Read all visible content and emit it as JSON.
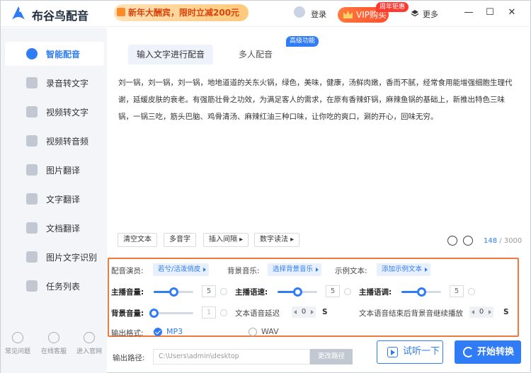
{
  "header": {
    "app_title": "布谷鸟配音",
    "promo": "新年大酬宾，限时立减200元",
    "login": "登录",
    "vip": "VIP购买",
    "vip_badge": "周年钜惠",
    "more": "更多",
    "window_controls": [
      "—",
      "☐",
      "✕"
    ]
  },
  "sidebar": {
    "items": [
      {
        "label": "智能配音",
        "icon": "microphone-icon"
      },
      {
        "label": "录音转文字",
        "icon": "audio-text-icon"
      },
      {
        "label": "视频转文字",
        "icon": "video-text-icon"
      },
      {
        "label": "视频转音频",
        "icon": "video-audio-icon"
      },
      {
        "label": "图片翻译",
        "icon": "image-translate-icon"
      },
      {
        "label": "文字翻译",
        "icon": "text-translate-icon"
      },
      {
        "label": "文档翻译",
        "icon": "doc-translate-icon"
      },
      {
        "label": "图片文字识别",
        "icon": "ocr-icon"
      },
      {
        "label": "任务列表",
        "icon": "task-list-icon"
      }
    ],
    "footer": [
      "常见问题",
      "在线客服",
      "进入官网"
    ]
  },
  "main": {
    "tabs": [
      "输入文字进行配音",
      "多人配音"
    ],
    "tab_badge": "高级功能",
    "text": "刘一锅，刘一锅，刘一锅，地地道道的关东火锅，绿色，美味，健康，汤鲜肉嫩，香而不腻，经常食用能增强细胞生理代谢，延缓皮肤的衰老。有强筋壮骨之功效，为满足客人的需求，在原有香辣虾锅，麻辣鱼锅的基础上，新推出特色三味锅，一锅三吃，筋头巴脑、鸡骨清汤、麻辣红油三种口味，让你吃的爽口，涮的开心，回味无穷。",
    "tools": [
      "清空文本",
      "多音字",
      "插入间隔 ▸",
      "数字读法 ▸"
    ],
    "char_count": "148",
    "char_limit": "/ 3000"
  },
  "settings": {
    "voice_label": "配音演员:",
    "voice_value": "若兮/活泼俏皮",
    "bgm_label": "背景音乐:",
    "bgm_value": "选择背景音乐",
    "sample_label": "示例文本:",
    "sample_value": "添加示例文本",
    "main_volume_label": "主播音量:",
    "main_volume": "5",
    "main_volume_level": 0.5,
    "speed_label": "主播语速:",
    "speed": "5",
    "speed_level": 0.5,
    "pitch_label": "主播语调:",
    "pitch": "5",
    "pitch_level": 0.5,
    "bg_volume_label": "背景音量:",
    "bg_volume": "1",
    "bg_volume_level": 0.0,
    "delay_label": "文本语音延迟",
    "delay_value": "0",
    "delay_unit": "S",
    "continue_label": "文本语音结束后背景音继续播放",
    "continue_value": "0",
    "continue_unit": "S",
    "format_label": "输出格式:",
    "format_mp3": "MP3",
    "format_wav": "WAV"
  },
  "output": {
    "path_label": "输出路径:",
    "path_value": "C:\\Users\\admin\\desktop",
    "change_path": "更改路径",
    "preview": "试听一下",
    "start": "开始转换"
  },
  "colors": {
    "accent": "#2f7cf6",
    "highlight_border": "#f07a3c",
    "vip": "#ff5a2e"
  }
}
